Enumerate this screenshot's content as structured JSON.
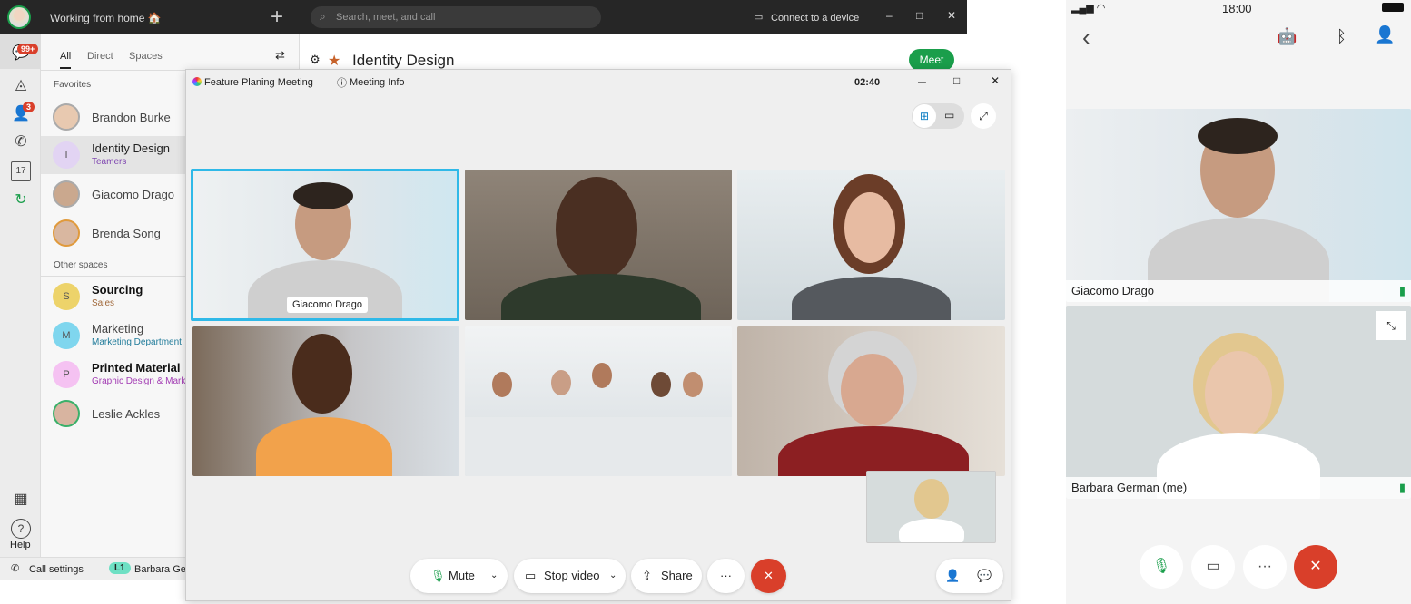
{
  "topbar": {
    "status": "Working from home 🏠",
    "search_placeholder": "Search, meet, and call",
    "connect": "Connect to a device"
  },
  "rail": {
    "messages_badge": "99+",
    "contacts_badge": "3",
    "calendar_day": "17",
    "help": "Help"
  },
  "list": {
    "tabs": [
      "All",
      "Direct",
      "Spaces"
    ],
    "favorites_header": "Favorites",
    "other_header": "Other spaces",
    "favorites": [
      {
        "name": "Brandon Burke",
        "initial": ""
      },
      {
        "name": "Identity Design",
        "sub": "Teamers",
        "initial": "I"
      },
      {
        "name": "Giacomo Drago"
      },
      {
        "name": "Brenda Song"
      }
    ],
    "others": [
      {
        "name": "Sourcing",
        "sub": "Sales",
        "initial": "S"
      },
      {
        "name": "Marketing",
        "sub": "Marketing Department",
        "initial": "M"
      },
      {
        "name": "Printed Material",
        "sub": "Graphic Design & Marketing",
        "initial": "P"
      },
      {
        "name": "Leslie Ackles"
      }
    ]
  },
  "bottombar": {
    "call_settings": "Call settings",
    "line": "L1",
    "user": "Barbara German"
  },
  "space": {
    "title": "Identity Design",
    "meet": "Meet"
  },
  "meeting": {
    "title": "Feature Planing Meeting",
    "info": "Meeting Info",
    "timer": "02:40",
    "active_speaker": "Giacomo Drago",
    "controls": {
      "mute": "Mute",
      "stop_video": "Stop video",
      "share": "Share",
      "more": "···"
    }
  },
  "phone": {
    "time": "18:00",
    "participants": [
      {
        "name": "Giacomo Drago"
      },
      {
        "name": "Barbara German (me)"
      }
    ]
  },
  "colors": {
    "accent_green": "#1a9e4b",
    "end_red": "#d93f2a",
    "active_border": "#2fb9e8"
  }
}
